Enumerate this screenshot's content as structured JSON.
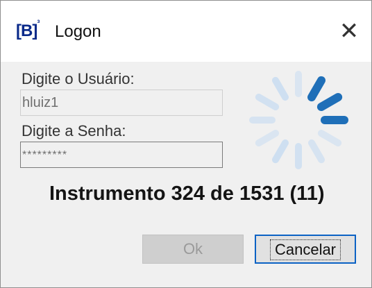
{
  "window": {
    "logo": "[B]",
    "logo_sup": "³",
    "title": "Logon",
    "close_glyph": "✕"
  },
  "form": {
    "user_label": "Digite o Usuário:",
    "user_value": "hluiz1",
    "pass_label": "Digite a Senha:",
    "pass_value": "*********"
  },
  "status_text": "Instrumento 324 de 1531 (11)",
  "buttons": {
    "ok": "Ok",
    "cancel": "Cancelar"
  },
  "spinner": {
    "icon": "loading-spinner-icon",
    "active_color": "#1f6fb8",
    "inactive_color": "#c9ddf2"
  }
}
